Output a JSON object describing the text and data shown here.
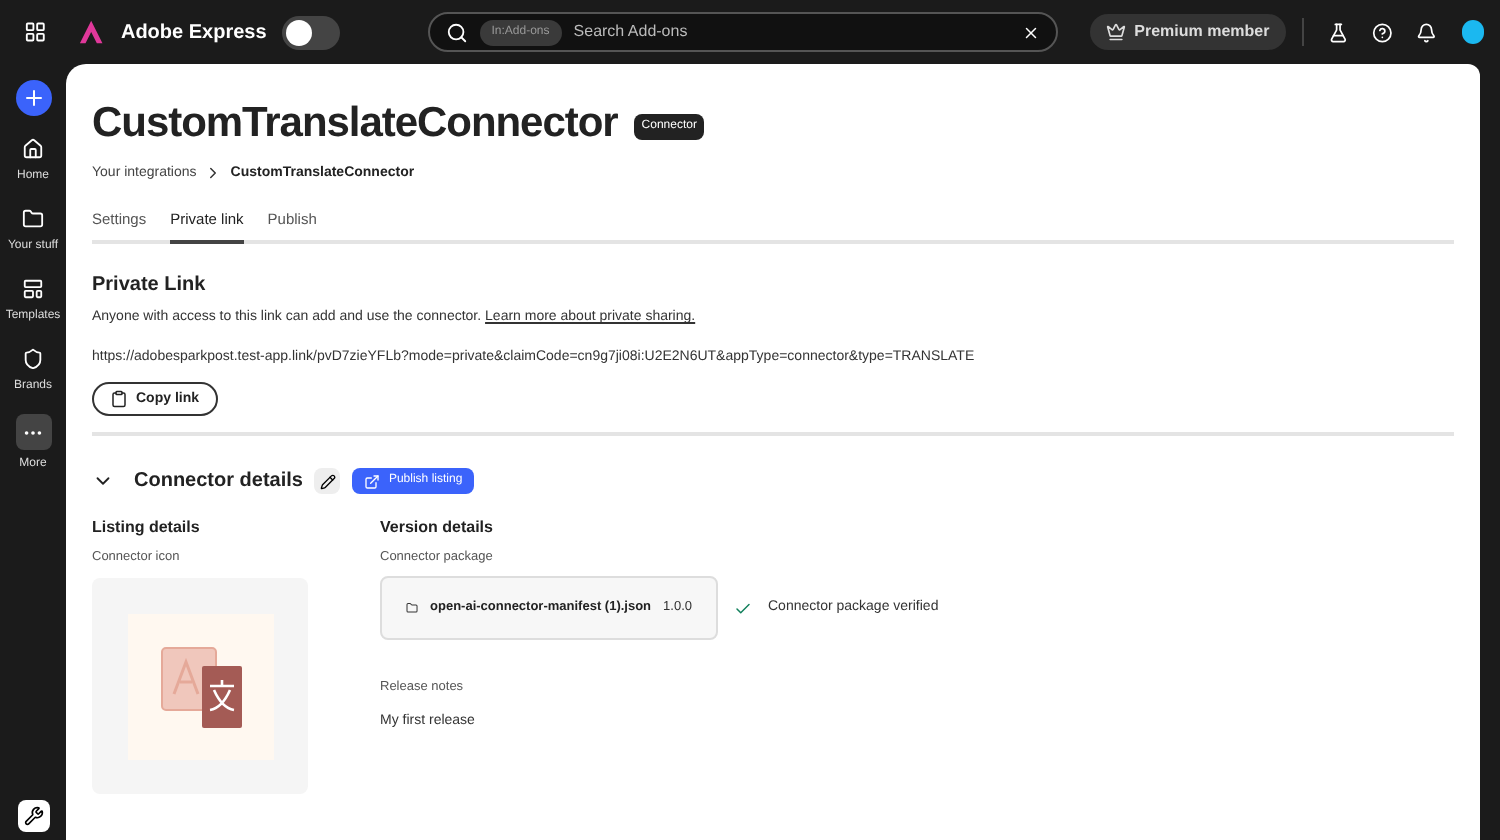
{
  "header": {
    "app_name": "Adobe Express",
    "theme_switch": {
      "on": false
    },
    "search": {
      "scope": "In:Add-ons",
      "placeholder": "Search Add-ons"
    },
    "premium": "Premium member"
  },
  "sidebar": {
    "items": [
      {
        "kind": "home",
        "label": "Home"
      },
      {
        "kind": "folder",
        "label": "Your stuff"
      },
      {
        "kind": "templates",
        "label": "Templates"
      },
      {
        "kind": "brands",
        "label": "Brands"
      },
      {
        "kind": "more",
        "label": "More"
      }
    ]
  },
  "page": {
    "title": "CustomTranslateConnector",
    "badge": "Connector",
    "breadcrumb": [
      "Your integrations",
      "CustomTranslateConnector"
    ],
    "tabs": [
      {
        "label": "Settings",
        "selected": false
      },
      {
        "label": "Private link",
        "selected": true
      },
      {
        "label": "Publish",
        "selected": false
      }
    ],
    "private_link": {
      "heading": "Private Link",
      "description": "Anyone with access to this link can add and use the connector.",
      "learn_more": "Learn more about private sharing.",
      "url": "https://adobesparkpost.test-app.link/pvD7zieYFLb?mode=private&claimCode=cn9g7ji08i:U2E2N6UT&appType=connector&type=TRANSLATE",
      "copy_button": "Copy link"
    },
    "connector_details": {
      "heading": "Connector details",
      "expanded": true,
      "publish_button": "Publish listing",
      "listing": {
        "heading": "Listing details",
        "icon_label": "Connector icon"
      },
      "version": {
        "heading": "Version details",
        "package_label": "Connector package",
        "file_name": "open-ai-connector-manifest (1).json",
        "file_version": "1.0.0",
        "status": "Connector package verified",
        "release_notes_label": "Release notes",
        "release_notes": "My first release"
      }
    }
  }
}
